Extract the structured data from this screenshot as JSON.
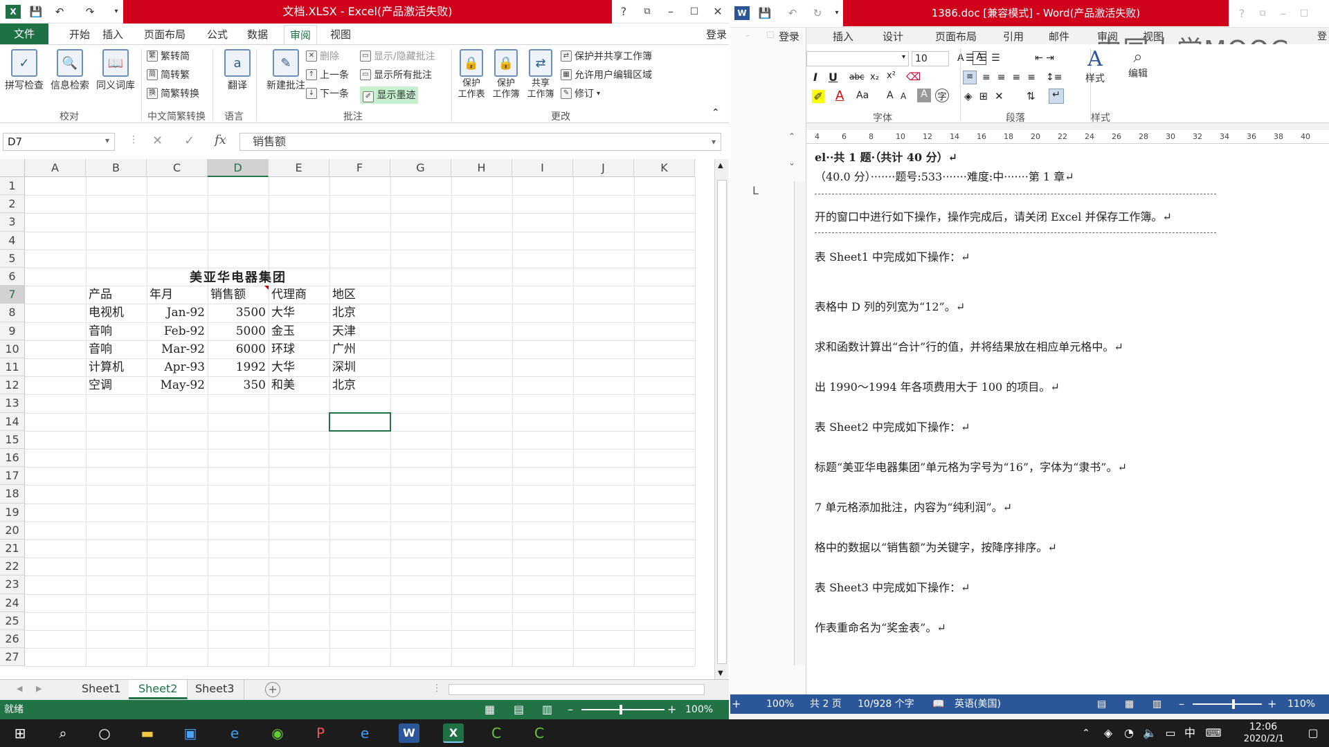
{
  "excel": {
    "title": "文档.XLSX - Excel(产品激活失败)",
    "login": "登录",
    "menu": [
      "文件",
      "开始",
      "插入",
      "页面布局",
      "公式",
      "数据",
      "审阅",
      "视图"
    ],
    "ribbon": {
      "spell": "拼写检查",
      "research": "信息检索",
      "thesaurus": "同义词库",
      "group_proof": "校对",
      "t2s": "繁转简",
      "s2t": "简转繁",
      "conv": "简繁转换",
      "group_cn": "中文简繁转换",
      "translate": "翻译",
      "group_lang": "语言",
      "newcomment": "新建批注",
      "delete": "删除",
      "prev": "上一条",
      "next": "下一条",
      "showhide": "显示/隐藏批注",
      "showall": "显示所有批注",
      "ink": "显示墨迹",
      "group_comment": "批注",
      "protect_sheet": "保护\n工作表",
      "protect_book": "保护\n工作簿",
      "share_book": "共享\n工作簿",
      "protect_share": "保护并共享工作簿",
      "allow_edit": "允许用户编辑区域",
      "track": "修订",
      "group_change": "更改"
    },
    "namebox": "D7",
    "formula": "销售额",
    "columns": [
      "A",
      "B",
      "C",
      "D",
      "E",
      "F",
      "G",
      "H",
      "I",
      "J",
      "K"
    ],
    "rows": [
      "1",
      "2",
      "3",
      "4",
      "5",
      "6",
      "7",
      "8",
      "9",
      "10",
      "11",
      "12",
      "13",
      "14",
      "15",
      "16",
      "17",
      "18",
      "19",
      "20",
      "21",
      "22",
      "23",
      "24",
      "25",
      "26",
      "27"
    ],
    "table": {
      "title": "美亚华电器集团",
      "header": [
        "产品",
        "年月",
        "销售额",
        "代理商",
        "地区"
      ],
      "rows": [
        [
          "电视机",
          "Jan-92",
          "3500",
          "大华",
          "北京"
        ],
        [
          "音响",
          "Feb-92",
          "5000",
          "金玉",
          "天津"
        ],
        [
          "音响",
          "Mar-92",
          "6000",
          "环球",
          "广州"
        ],
        [
          "计算机",
          "Apr-93",
          "1992",
          "大华",
          "深圳"
        ],
        [
          "空调",
          "May-92",
          "350",
          "和美",
          "北京"
        ]
      ]
    },
    "sheets": [
      "Sheet1",
      "Sheet2",
      "Sheet3"
    ],
    "status": "就绪",
    "zoom": "100%"
  },
  "word": {
    "title": "1386.doc [兼容模式] - Word(产品激活失败)",
    "login": "登录",
    "menu": [
      "插入",
      "设计",
      "页面布局",
      "引用",
      "邮件",
      "审阅",
      "视图"
    ],
    "font_size": "10",
    "groups": {
      "font": "字体",
      "para": "段落",
      "style": "样式",
      "styles_btn": "样式",
      "edit_btn": "编辑"
    },
    "ruler": [
      "4",
      "6",
      "8",
      "10",
      "12",
      "14",
      "16",
      "18",
      "20",
      "22",
      "24",
      "26",
      "28",
      "30",
      "32",
      "34",
      "36",
      "38",
      "40"
    ],
    "nav_label": "L",
    "nav_zoom": "100%",
    "lines": [
      "el··共 1 题·（共计 40 分）↵",
      "（40.0 分）·······题号:533·······难度:中·······第 1 章↵",
      "开的窗口中进行如下操作，操作完成后，请关闭 Excel 并保存工作簿。↵",
      "表 Sheet1 中完成如下操作：↵",
      "表格中 D 列的列宽为“12”。↵",
      "求和函数计算出“合计”行的值，并将结果放在相应单元格中。↵",
      "出 1990～1994 年各项费用大于 100 的项目。↵",
      "表 Sheet2 中完成如下操作：↵",
      "标题“美亚华电器集团”单元格为字号为“16”，字体为“隶书”。↵",
      "7 单元格添加批注，内容为“纯利润”。↵",
      "格中的数据以“销售额”为关键字，按降序排序。↵",
      "表 Sheet3 中完成如下操作：↵",
      "作表重命名为“奖金表”。↵"
    ],
    "status": {
      "pages": "共 2 页",
      "words": "10/928 个字",
      "lang": "英语(美国)",
      "zoom": "110%"
    }
  },
  "watermark": "中国大学MOOC",
  "taskbar": {
    "time": "12:06",
    "date": "2020/2/1",
    "ime": "中"
  }
}
